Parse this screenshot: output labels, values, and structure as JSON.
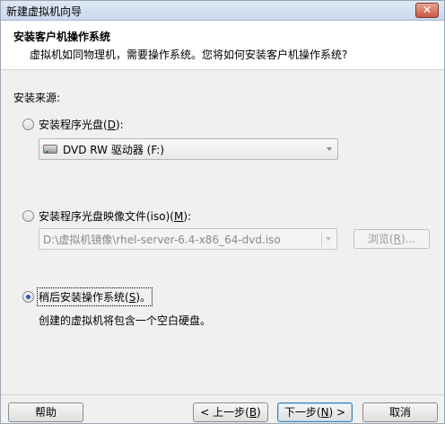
{
  "window": {
    "title": "新建虚拟机向导",
    "close_symbol": "✕"
  },
  "header": {
    "title": "安装客户机操作系统",
    "subtitle": "虚拟机如同物理机，需要操作系统。您将如何安装客户机操作系统?"
  },
  "source_label": "安装来源:",
  "options": {
    "disc": {
      "label_prefix": "安装程序光盘(",
      "mnemonic": "D",
      "label_suffix": "):",
      "selected": false
    },
    "drive_combo": {
      "value": "DVD RW 驱动器 (F:)",
      "icon": "dvd-drive-icon"
    },
    "iso": {
      "label_prefix": "安装程序光盘映像文件(iso)(",
      "mnemonic": "M",
      "label_suffix": "):",
      "selected": false
    },
    "iso_combo": {
      "value": "D:\\虚拟机镜像\\rhel-server-6.4-x86_64-dvd.iso"
    },
    "browse": {
      "label_prefix": "浏览(",
      "mnemonic": "R",
      "label_suffix": ")..."
    },
    "later": {
      "label_prefix": "稍后安装操作系统(",
      "mnemonic": "S",
      "label_suffix": ")。",
      "selected": true
    },
    "later_note": "创建的虚拟机将包含一个空白硬盘。"
  },
  "buttons": {
    "help": "帮助",
    "back": {
      "prefix": "< 上一步(",
      "mnemonic": "B",
      "suffix": ")"
    },
    "next": {
      "prefix": "下一步(",
      "mnemonic": "N",
      "suffix": ") >"
    },
    "cancel": "取消"
  }
}
